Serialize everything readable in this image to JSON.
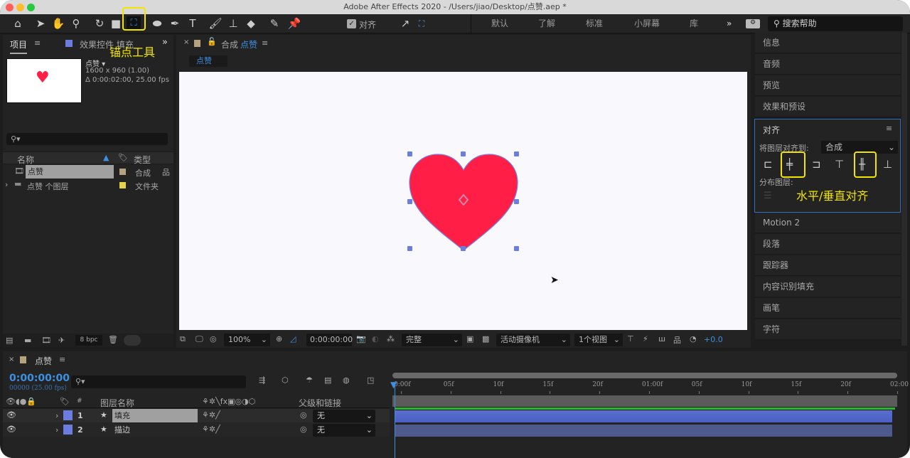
{
  "window": {
    "title": "Adobe After Effects 2020 - /Users/jiao/Desktop/点赞.aep *"
  },
  "toolbar": {
    "snap_label": "对齐",
    "workspaces": [
      "默认",
      "了解",
      "标准",
      "小屏幕",
      "库"
    ],
    "search_placeholder": "搜索帮助",
    "anchor_tool_annotation": "锚点工具",
    "tools": [
      "home-icon",
      "selection-icon",
      "hand-icon",
      "zoom-icon",
      "rotate-icon",
      "camera-icon",
      "anchor-point-icon",
      "ellipse-icon",
      "pen-icon",
      "type-icon",
      "brush-icon",
      "clone-stamp-icon",
      "eraser-icon",
      "roto-brush-icon",
      "puppet-pin-icon"
    ]
  },
  "project_panel": {
    "tab_project": "项目",
    "tab_effects": "效果控件 填充",
    "comp_name": "点赞 ▾",
    "comp_size": "1600 x 960 (1.00)",
    "comp_duration": "Δ 0:00:02:00, 25.00 fps",
    "col_name": "名称",
    "col_type": "类型",
    "items": [
      {
        "name": "点赞",
        "type": "合成",
        "color": "#b5a27f"
      },
      {
        "name": "点赞 个图层",
        "type": "文件夹",
        "color": "#e6d24a"
      }
    ],
    "bpc": "8 bpc"
  },
  "comp_panel": {
    "tab_prefix": "合成",
    "tab_name": "点赞",
    "breadcrumb": "点赞",
    "zoom": "100%",
    "timecode": "0:00:00:00",
    "resolution": "完整",
    "camera": "活动摄像机",
    "views": "1个视图",
    "exposure": "+0.0",
    "heart_color": "#ff1e46",
    "bg_color": "#f8f8fd"
  },
  "right_panel": {
    "items_top": [
      "信息",
      "音频",
      "预览",
      "效果和预设"
    ],
    "align": {
      "title": "对齐",
      "align_to_label": "将图层对齐到:",
      "align_to_value": "合成",
      "distribute_label": "分布图层:",
      "annotation": "水平/垂直对齐"
    },
    "items_bottom": [
      "Motion 2",
      "段落",
      "跟踪器",
      "内容识别填充",
      "画笔",
      "字符"
    ]
  },
  "timeline": {
    "comp_name": "点赞",
    "timecode": "0:00:00:00",
    "frame_info": "00000 (25.00 fps)",
    "col_layer_name": "图层名称",
    "col_parent": "父级和链接",
    "layers": [
      {
        "index": "1",
        "name": "填充",
        "parent": "无",
        "color": "#6b7ee0"
      },
      {
        "index": "2",
        "name": "描边",
        "parent": "无",
        "color": "#6b7ee0"
      }
    ],
    "ruler_ticks": [
      "0:00f",
      "05f",
      "10f",
      "15f",
      "20f",
      "01:00f",
      "05f",
      "10f",
      "15f",
      "20f",
      "02:00"
    ]
  }
}
